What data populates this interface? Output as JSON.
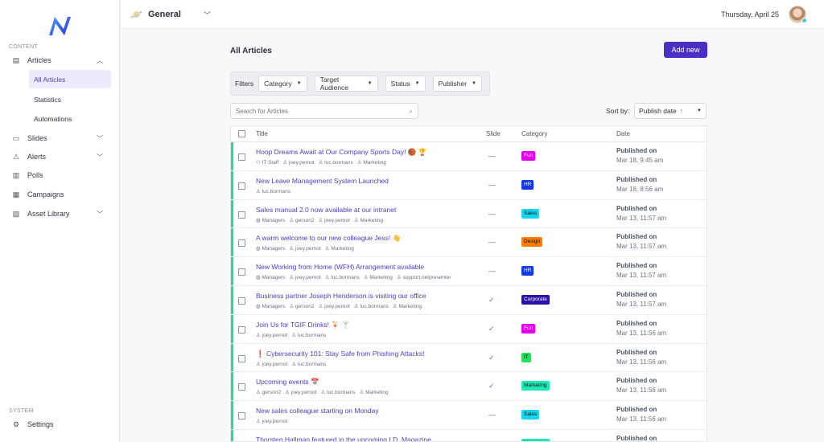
{
  "sidebar": {
    "content_label": "CONTENT",
    "articles_label": "Articles",
    "sub_items": [
      "All Articles",
      "Statistics",
      "Automations"
    ],
    "slides_label": "Slides",
    "alerts_label": "Alerts",
    "polls_label": "Polls",
    "campaigns_label": "Campaigns",
    "asset_library_label": "Asset Library",
    "system_label": "SYSTEM",
    "settings_label": "Settings"
  },
  "topbar": {
    "workspace": "General",
    "date": "Thursday, April 25"
  },
  "page": {
    "title": "All Articles",
    "add_button": "Add new",
    "filters_label": "Filters",
    "filters": [
      "Category",
      "Target Audience",
      "Status",
      "Publisher"
    ],
    "search_placeholder": "Search for Articles",
    "sort_label": "Sort by:",
    "sort_value": "Publish date"
  },
  "table": {
    "headers": {
      "title": "Title",
      "slide": "Slide",
      "category": "Category",
      "date": "Date"
    },
    "rows": [
      {
        "title": "Hoop Dreams Await at Our Company Sports Day! 🏀 🏆",
        "meta": [
          "IT Staff",
          "joey.pernot",
          "luc.bormans",
          "Marketing"
        ],
        "slide": "—",
        "category": "Fun",
        "cat_bg": "#e100e8",
        "cat_fg": "#ffffff",
        "published": "Published on",
        "date": "Mar 18, 9:45 am"
      },
      {
        "title": "New Leave Management System Launched",
        "meta": [
          "luc.bormans"
        ],
        "slide": "—",
        "category": "HR",
        "cat_bg": "#1338e6",
        "cat_fg": "#ffffff",
        "published": "Published on",
        "date": "Mar 18, 8:56 am"
      },
      {
        "title": "Sales manual 2.0 now available at our intranet",
        "meta": [
          "Managers",
          "gerson2",
          "joey.pernot",
          "Marketing"
        ],
        "slide": "—",
        "category": "Sales",
        "cat_bg": "#14d7ee",
        "cat_fg": "#111111",
        "published": "Published on",
        "date": "Mar 13, 11:57 am"
      },
      {
        "title": "A warm welcome to our new colleague Jess! 👋",
        "meta": [
          "Managers",
          "joey.pernot",
          "Marketing"
        ],
        "slide": "—",
        "category": "Design",
        "cat_bg": "#ff7a00",
        "cat_fg": "#111111",
        "published": "Published on",
        "date": "Mar 13, 11:57 am"
      },
      {
        "title": "New Working from Home (WFH) Arrangement available",
        "meta": [
          "Managers",
          "joey.pernot",
          "luc.bormans",
          "Marketing",
          "support.netpresenter"
        ],
        "slide": "—",
        "category": "HR",
        "cat_bg": "#1338e6",
        "cat_fg": "#ffffff",
        "published": "Published on",
        "date": "Mar 13, 11:57 am"
      },
      {
        "title": "Business partner Joseph Henderson is visiting our office",
        "meta": [
          "Managers",
          "gerson2",
          "joey.pernot",
          "luc.bormans",
          "Marketing"
        ],
        "slide": "✓",
        "category": "Corporate",
        "cat_bg": "#2a12a8",
        "cat_fg": "#ffffff",
        "published": "Published on",
        "date": "Mar 13, 11:57 am"
      },
      {
        "title": "Join Us for TGIF Drinks! 🍹 🍸",
        "meta": [
          "joey.pernot",
          "luc.bormans"
        ],
        "slide": "✓",
        "category": "Fun",
        "cat_bg": "#e100e8",
        "cat_fg": "#ffffff",
        "published": "Published on",
        "date": "Mar 13, 11:56 am"
      },
      {
        "title": "❗ Cybersecurity 101: Stay Safe from Phishing Attacks!",
        "meta": [
          "joey.pernot",
          "luc.bormans"
        ],
        "slide": "✓",
        "category": "IT",
        "cat_bg": "#22e05a",
        "cat_fg": "#111111",
        "published": "Published on",
        "date": "Mar 13, 11:56 am"
      },
      {
        "title": "Upcoming events 📅",
        "meta": [
          "gerson2",
          "joey.pernot",
          "luc.bormans",
          "Marketing"
        ],
        "slide": "✓",
        "category": "Marketing",
        "cat_bg": "#1de9b6",
        "cat_fg": "#111111",
        "published": "Published on",
        "date": "Mar 13, 11:56 am"
      },
      {
        "title": "New sales colleague starting on Monday",
        "meta": [
          "joey.pernot"
        ],
        "slide": "—",
        "category": "Sales",
        "cat_bg": "#14d7ee",
        "cat_fg": "#111111",
        "published": "Published on",
        "date": "Mar 13, 11:56 am"
      },
      {
        "title": "Thorsten Hallman featured in the upcoming I.D. Magazine",
        "meta": [],
        "slide": "✓",
        "category": "Marketing",
        "cat_bg": "#1de9b6",
        "cat_fg": "#111111",
        "published": "Published on",
        "date": ""
      }
    ]
  },
  "colors": {
    "accent": "#4b2fc4",
    "link": "#4b3fc6",
    "row_indicator": "#34d399"
  }
}
